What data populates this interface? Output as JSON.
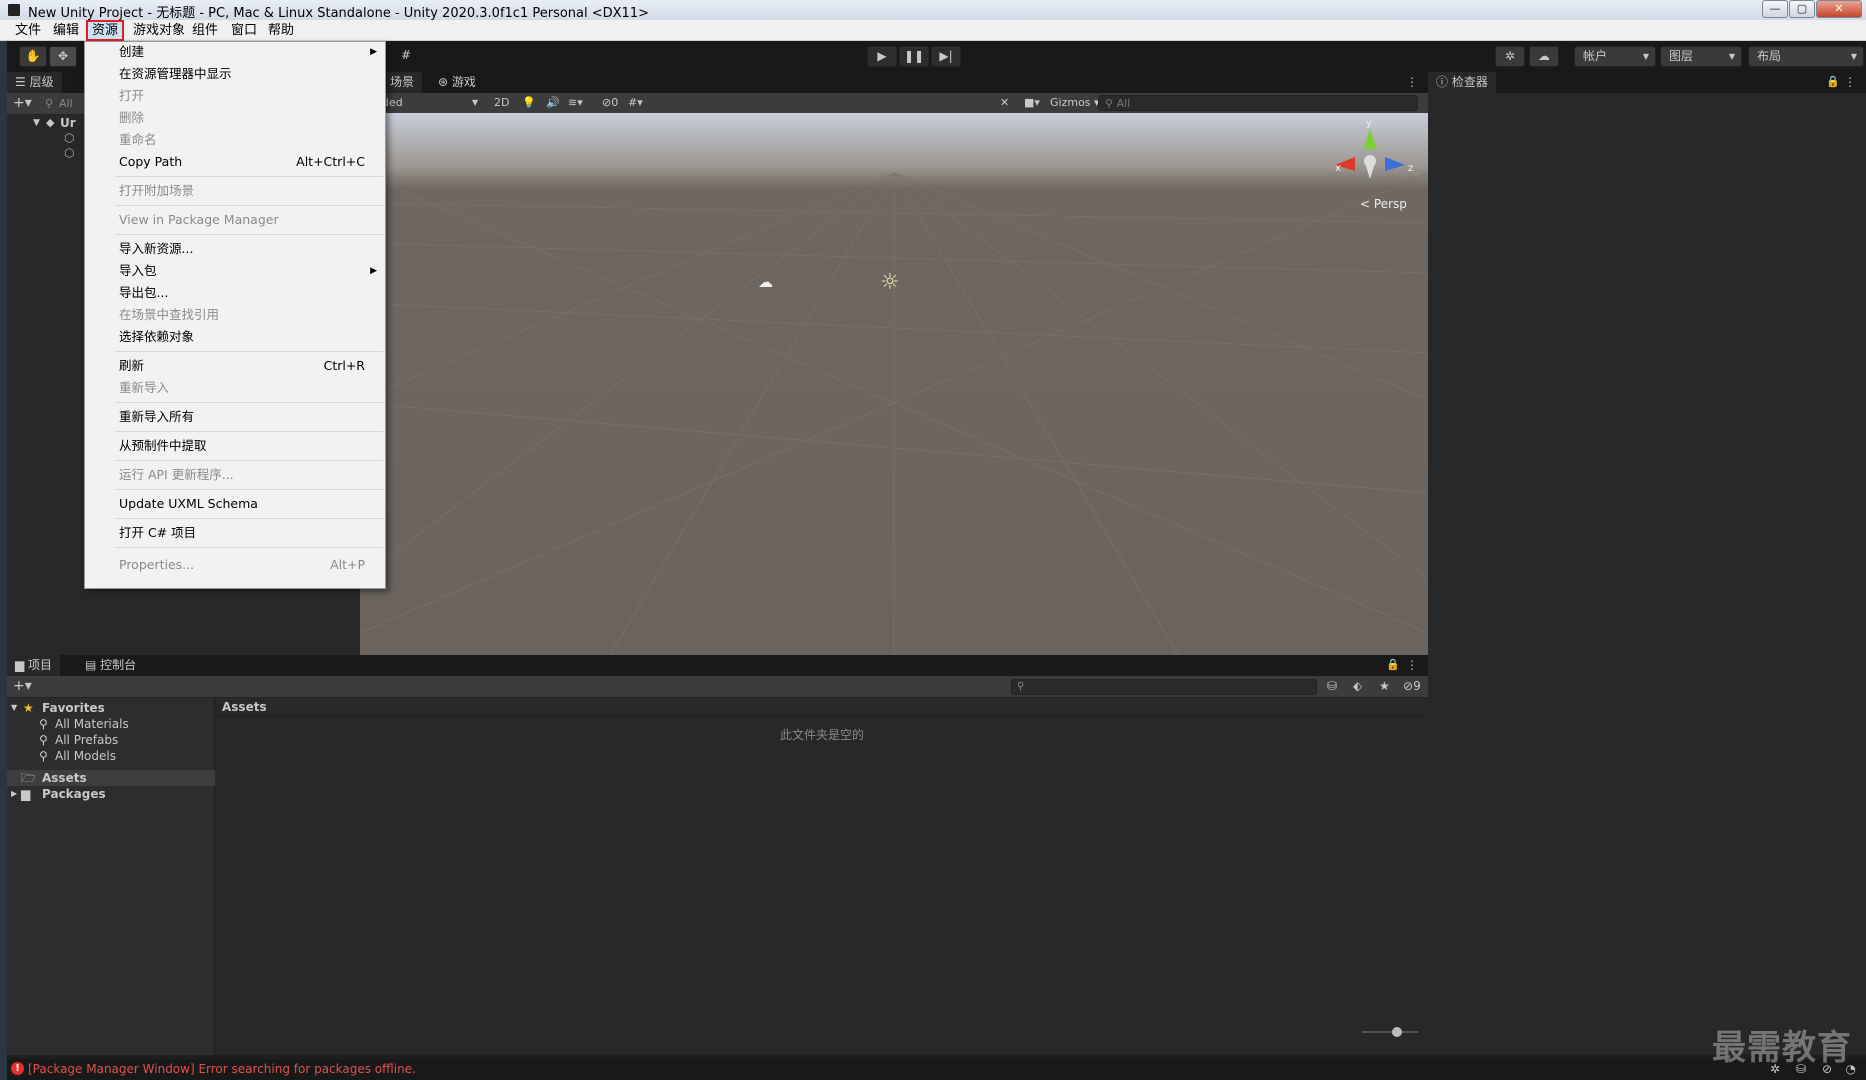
{
  "window": {
    "title": "New Unity Project - 无标题 - PC, Mac & Linux Standalone - Unity 2020.3.0f1c1 Personal <DX11>",
    "min": "—",
    "max": "▢",
    "close": "✕"
  },
  "menubar": {
    "file": "文件",
    "edit": "编辑",
    "assets": "资源",
    "gameobject": "游戏对象",
    "component": "组件",
    "window": "窗口",
    "help": "帮助"
  },
  "toolbar": {
    "account": "帐户",
    "layers": "图层",
    "layout": "布局"
  },
  "hierarchy": {
    "tab": "层级",
    "search_placeholder": "All",
    "scene_label": "Ur"
  },
  "scene": {
    "tab_scene": "场景",
    "tab_game": "游戏",
    "shading_mode": "ded",
    "mode_2d": "2D",
    "hidden_count": "0",
    "gizmos": "Gizmos",
    "search_placeholder": "All",
    "axis_x": "x",
    "axis_y": "y",
    "axis_z": "z",
    "persp": "Persp"
  },
  "inspector": {
    "tab": "检查器"
  },
  "project": {
    "tab_project": "项目",
    "tab_console": "控制台",
    "hidden_count": "9",
    "favorites": "Favorites",
    "fav_items": [
      "All Materials",
      "All Prefabs",
      "All Models"
    ],
    "assets_root": "Assets",
    "packages_root": "Packages",
    "breadcrumb": "Assets",
    "empty_message": "此文件夹是空的"
  },
  "status": {
    "error_message": "[Package Manager Window] Error searching for packages offline."
  },
  "context_menu": {
    "create": "创建",
    "show_in_explorer": "在资源管理器中显示",
    "open": "打开",
    "delete": "删除",
    "rename": "重命名",
    "copy_path": "Copy Path",
    "copy_path_shortcut": "Alt+Ctrl+C",
    "open_additive_scene": "打开附加场景",
    "view_in_package_manager": "View in Package Manager",
    "import_new_asset": "导入新资源...",
    "import_package": "导入包",
    "export_package": "导出包...",
    "find_references": "在场景中查找引用",
    "select_dependencies": "选择依赖对象",
    "refresh": "刷新",
    "refresh_shortcut": "Ctrl+R",
    "reimport": "重新导入",
    "reimport_all": "重新导入所有",
    "extract_from_prefab": "从预制件中提取",
    "run_api_updater": "运行 API 更新程序...",
    "update_uxml_schema": "Update UXML Schema",
    "open_csharp_project": "打开 C# 项目",
    "properties": "Properties...",
    "properties_shortcut": "Alt+P"
  },
  "watermark": "最需教育"
}
